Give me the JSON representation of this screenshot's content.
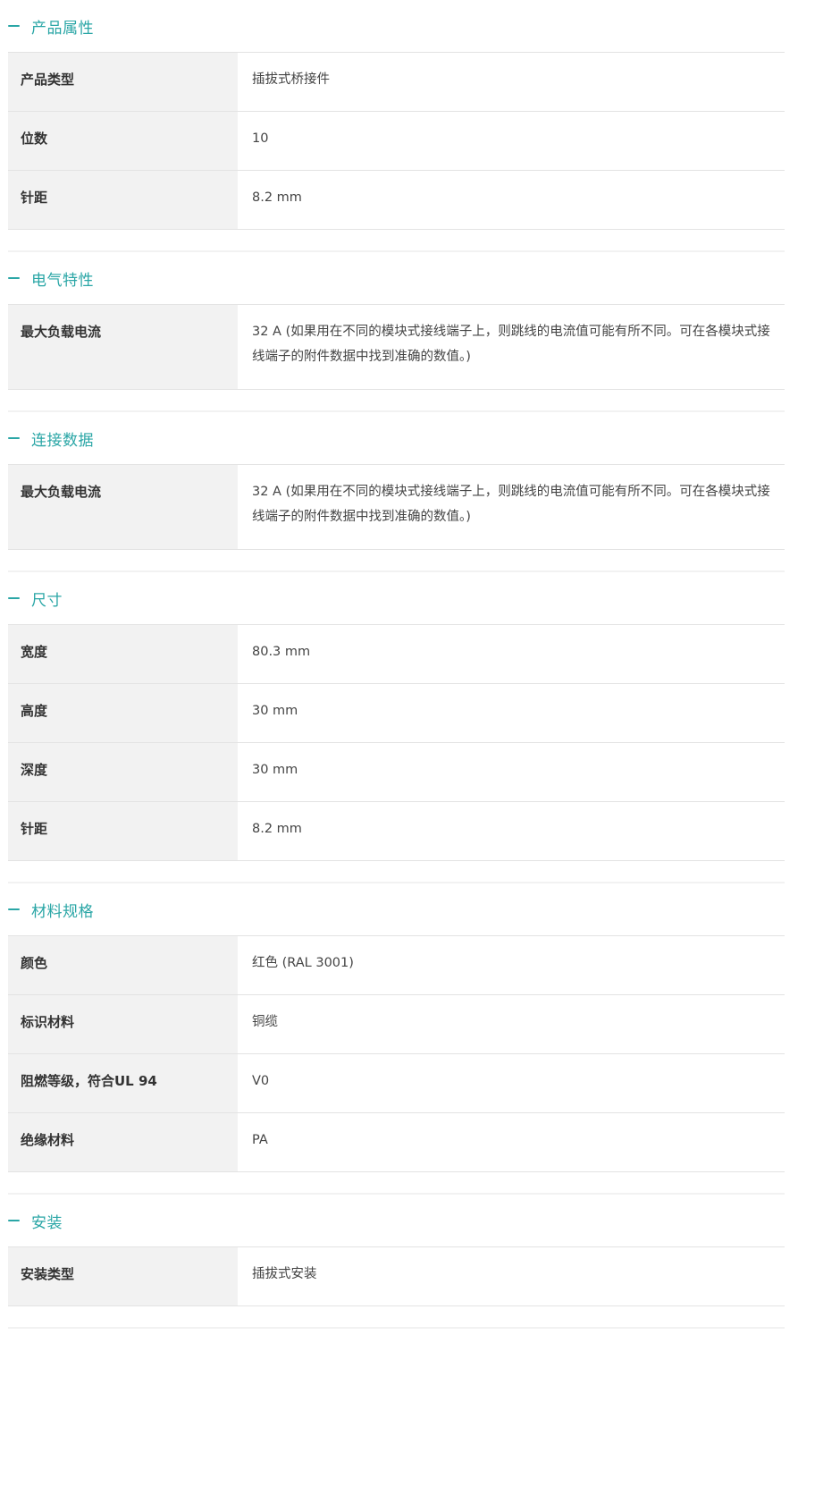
{
  "sections": [
    {
      "title": "产品属性",
      "rows": [
        {
          "label": "产品类型",
          "value": "插拔式桥接件"
        },
        {
          "label": "位数",
          "value": "10"
        },
        {
          "label": "针距",
          "value": "8.2 mm"
        }
      ]
    },
    {
      "title": "电气特性",
      "rows": [
        {
          "label": "最大负载电流",
          "value": "32 A (如果用在不同的模块式接线端子上，则跳线的电流值可能有所不同。可在各模块式接线端子的附件数据中找到准确的数值。)"
        }
      ]
    },
    {
      "title": "连接数据",
      "rows": [
        {
          "label": "最大负载电流",
          "value": "32 A (如果用在不同的模块式接线端子上，则跳线的电流值可能有所不同。可在各模块式接线端子的附件数据中找到准确的数值。)"
        }
      ]
    },
    {
      "title": "尺寸",
      "rows": [
        {
          "label": "宽度",
          "value": "80.3 mm"
        },
        {
          "label": "高度",
          "value": "30 mm"
        },
        {
          "label": "深度",
          "value": "30 mm"
        },
        {
          "label": "针距",
          "value": "8.2 mm"
        }
      ]
    },
    {
      "title": "材料规格",
      "rows": [
        {
          "label": "颜色",
          "value": "红色 (RAL 3001)"
        },
        {
          "label": "标识材料",
          "value": "铜缆"
        },
        {
          "label": "阻燃等级，符合UL 94",
          "value": "V0"
        },
        {
          "label": "绝缘材料",
          "value": "PA"
        }
      ]
    },
    {
      "title": "安装",
      "rows": [
        {
          "label": "安装类型",
          "value": "插拔式安装"
        }
      ]
    }
  ],
  "colors": {
    "accent": "#2aa6a6",
    "label_bg": "#f2f2f2",
    "border": "#e3e3e3"
  },
  "icons": {
    "section_toggle": "minus-icon"
  }
}
